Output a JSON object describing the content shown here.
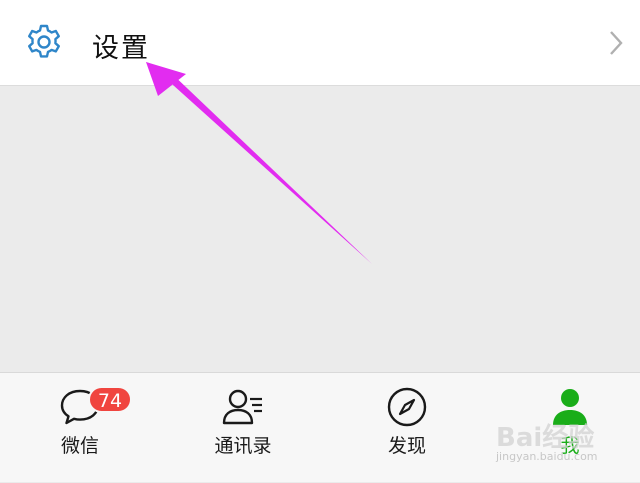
{
  "settings": {
    "label": "设置",
    "icon": "gear-icon",
    "chevron": "chevron-right-icon"
  },
  "colors": {
    "accent_green": "#1aad19",
    "badge_red": "#f0453f",
    "annotation_arrow": "#e22cf0"
  },
  "tabs": [
    {
      "label": "微信",
      "icon": "chat-bubble-icon",
      "badge": "74",
      "active": false
    },
    {
      "label": "通讯录",
      "icon": "contacts-icon",
      "active": false
    },
    {
      "label": "发现",
      "icon": "compass-icon",
      "active": false
    },
    {
      "label": "我",
      "icon": "person-icon",
      "active": true
    }
  ],
  "watermark": {
    "logo_text": "Bai经验",
    "url": "jingyan.baidu.com"
  }
}
